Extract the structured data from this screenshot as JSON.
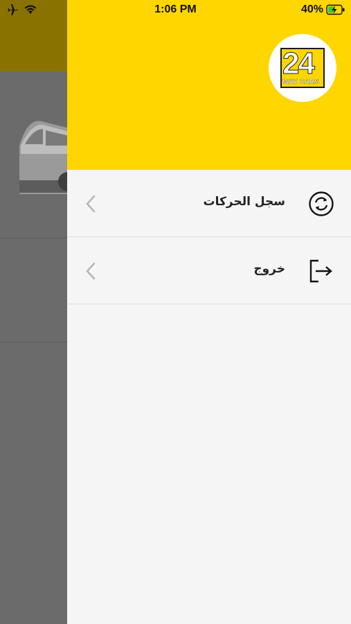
{
  "status_bar": {
    "time": "1:06 PM",
    "battery_percent": "40%",
    "icons": [
      "airplane-icon",
      "wifi-icon",
      "battery-charging-icon"
    ]
  },
  "drawer": {
    "logo": {
      "number": "24",
      "caption": "WAY CARS",
      "alt": "24 Way Cars logo"
    },
    "items": [
      {
        "label": "سجل الحركات",
        "icon": "history-sync-icon"
      },
      {
        "label": "خروج",
        "icon": "logout-icon"
      }
    ]
  },
  "colors": {
    "brand_yellow": "#ffd600",
    "drawer_bg": "#f5f5f5",
    "overlay": "#6b6b6b"
  }
}
